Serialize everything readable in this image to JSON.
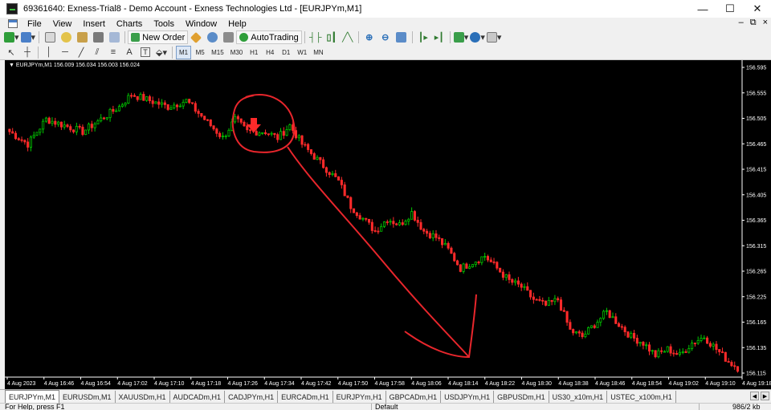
{
  "window": {
    "title": "69361640: Exness-Trial8 - Demo Account - Exness Technologies Ltd - [EURJPYm,M1]",
    "controls": {
      "minimize": "—",
      "maximize": "☐",
      "close": "✕"
    }
  },
  "menu": {
    "items": [
      "File",
      "View",
      "Insert",
      "Charts",
      "Tools",
      "Window",
      "Help"
    ],
    "mdi": {
      "minimize": "–",
      "restore": "⧉",
      "close": "×"
    }
  },
  "toolbar": {
    "new_order": "New Order",
    "autotrading": "AutoTrading",
    "timeframes": [
      "M1",
      "M5",
      "M15",
      "M30",
      "H1",
      "H4",
      "D1",
      "W1",
      "MN"
    ],
    "active_timeframe": "M1",
    "text_tool": "A",
    "label_tool": "T"
  },
  "chart": {
    "label": "▼ EURJPYm,M1  156.009 156.034 156.003 156.024",
    "colors": {
      "bull": "#00c800",
      "bear": "#ff2a2a",
      "annotation": "#e8262c",
      "axis_text": "#ffffff"
    }
  },
  "chart_data": {
    "type": "candlestick",
    "symbol": "EURJPYm",
    "timeframe": "M1",
    "ohlc_last": {
      "open": 156.009,
      "high": 156.034,
      "low": 156.003,
      "close": 156.024
    },
    "y_ticks": [
      "156.595",
      "156.555",
      "156.505",
      "156.465",
      "156.415",
      "156.405",
      "156.365",
      "156.315",
      "156.265",
      "156.225",
      "156.165",
      "156.135",
      "156.115"
    ],
    "x_ticks": [
      "4 Aug 2023",
      "4 Aug 16:46",
      "4 Aug 16:54",
      "4 Aug 17:02",
      "4 Aug 17:10",
      "4 Aug 17:18",
      "4 Aug 17:26",
      "4 Aug 17:34",
      "4 Aug 17:42",
      "4 Aug 17:50",
      "4 Aug 17:58",
      "4 Aug 18:06",
      "4 Aug 18:14",
      "4 Aug 18:22",
      "4 Aug 18:30",
      "4 Aug 18:38",
      "4 Aug 18:46",
      "4 Aug 18:54",
      "4 Aug 19:02",
      "4 Aug 19:10",
      "4 Aug 19:18"
    ],
    "ylim": [
      156.095,
      156.605
    ],
    "close_anchors": [
      [
        0,
        156.49
      ],
      [
        6,
        156.47
      ],
      [
        12,
        156.51
      ],
      [
        18,
        156.5
      ],
      [
        24,
        156.49
      ],
      [
        30,
        156.51
      ],
      [
        36,
        156.53
      ],
      [
        40,
        156.55
      ],
      [
        46,
        156.54
      ],
      [
        52,
        156.53
      ],
      [
        58,
        156.54
      ],
      [
        62,
        156.52
      ],
      [
        66,
        156.5
      ],
      [
        70,
        156.48
      ],
      [
        74,
        156.51
      ],
      [
        78,
        156.49
      ],
      [
        84,
        156.49
      ],
      [
        88,
        156.48
      ],
      [
        92,
        156.5
      ],
      [
        96,
        156.47
      ],
      [
        100,
        156.45
      ],
      [
        104,
        156.43
      ],
      [
        108,
        156.41
      ],
      [
        112,
        156.37
      ],
      [
        116,
        156.35
      ],
      [
        120,
        156.33
      ],
      [
        124,
        156.35
      ],
      [
        128,
        156.34
      ],
      [
        132,
        156.36
      ],
      [
        136,
        156.33
      ],
      [
        140,
        156.32
      ],
      [
        144,
        156.3
      ],
      [
        148,
        156.27
      ],
      [
        152,
        156.28
      ],
      [
        156,
        156.29
      ],
      [
        160,
        156.27
      ],
      [
        164,
        156.25
      ],
      [
        168,
        156.24
      ],
      [
        172,
        156.22
      ],
      [
        176,
        156.21
      ],
      [
        180,
        156.22
      ],
      [
        184,
        156.17
      ],
      [
        188,
        156.16
      ],
      [
        192,
        156.18
      ],
      [
        196,
        156.2
      ],
      [
        200,
        156.18
      ],
      [
        204,
        156.16
      ],
      [
        208,
        156.15
      ],
      [
        212,
        156.13
      ],
      [
        216,
        156.14
      ],
      [
        220,
        156.13
      ],
      [
        224,
        156.15
      ],
      [
        228,
        156.16
      ],
      [
        232,
        156.14
      ],
      [
        236,
        156.12
      ],
      [
        239,
        156.11
      ]
    ],
    "annotation": {
      "shape": "circle-and-arrow",
      "color": "#e8262c"
    },
    "signal_arrow": {
      "direction": "down",
      "color": "#ff2a2a"
    }
  },
  "tabs": [
    "EURJPYm,M1",
    "EURUSDm,M1",
    "XAUUSDm,H1",
    "AUDCADm,H1",
    "CADJPYm,H1",
    "EURCADm,H1",
    "EURJPYm,H1",
    "GBPCADm,H1",
    "USDJPYm,H1",
    "GBPUSDm,H1",
    "US30_x10m,H1",
    "USTEC_x100m,H1"
  ],
  "active_tab": "EURJPYm,M1",
  "status": {
    "help": "For Help, press F1",
    "profile": "Default",
    "traffic": "986/2 kb"
  }
}
